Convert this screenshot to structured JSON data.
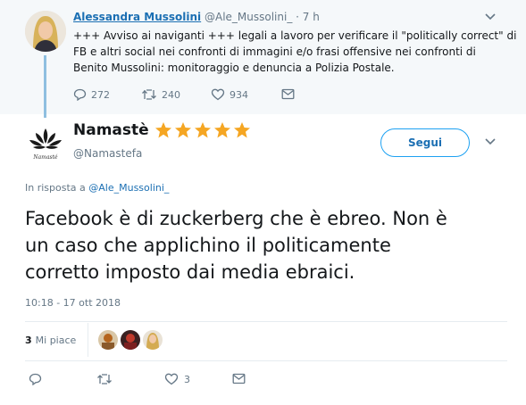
{
  "parent_tweet": {
    "author_name": "Alessandra Mussolini",
    "author_handle": "@Ale_Mussolini_",
    "time": "· 7 h",
    "text_lines": [
      "+++ Avviso ai naviganti +++ legali a lavoro per verificare il \"politically correct\" di",
      "FB e altri social nei confronti di immagini e/o frasi offensive nei confronti di",
      "Benito Mussolini: monitoraggio e denuncia a Polizia Postale."
    ],
    "actions": {
      "replies": "272",
      "retweets": "240",
      "likes": "934"
    }
  },
  "main_tweet": {
    "author_name": "Namastè",
    "author_handle": "@Namastefa",
    "follow_label": "Segui",
    "reply_prefix": "In risposta a",
    "reply_handle": "@Ale_Mussolini_",
    "text_lines": [
      "Facebook è di zuckerberg che è ebreo. Non è",
      "un caso che applichino il politicamente",
      "corretto imposto dai media ebraici."
    ],
    "timestamp": "10:18 - 17 ott 2018",
    "likes_count": "3",
    "likes_label": "Mi piace",
    "actions": {
      "replies": "",
      "retweets": "",
      "likes": "3"
    }
  },
  "colors": {
    "link": "#1b6fb3",
    "accent": "#1da1f2",
    "muted": "#657786",
    "star": "#f5a623",
    "parent_bg": "#f5f8fa"
  },
  "icons": [
    "reply-icon",
    "retweet-icon",
    "heart-icon",
    "message-icon",
    "chevron-down-icon",
    "star-icon"
  ]
}
